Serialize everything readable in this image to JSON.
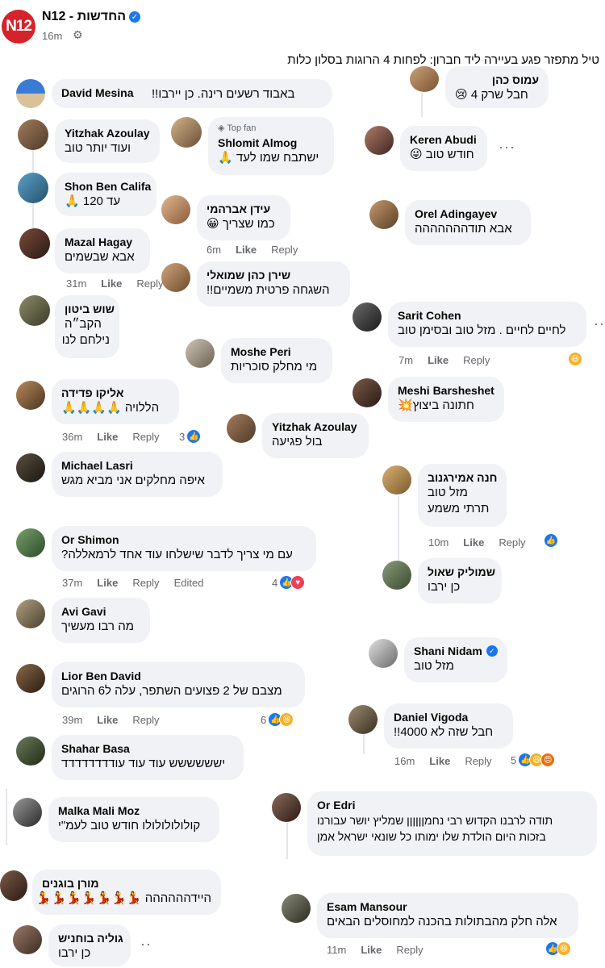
{
  "header": {
    "logo_text": "N12",
    "page_name": "N12 - החדשות",
    "post_time": "16m",
    "headline": "טיל מתפזר פגע בעיירה ליד חברון: לפחות 4 הרוגות בסלון כלות"
  },
  "colors": {
    "accent": "#1877f2",
    "bubble": "#f0f2f5",
    "brand": "#d5232c"
  },
  "actions": {
    "like": "Like",
    "reply": "Reply",
    "edited": "Edited"
  },
  "comments": [
    {
      "name": "David Mesina",
      "text": "באבוד רשעים רינה. כן יירבו!!"
    },
    {
      "name": "עמוס כהן",
      "text": "חבל שרק 4 😢"
    },
    {
      "name": "Yitzhak Azoulay",
      "text": "ועוד יותר טוב"
    },
    {
      "name": "Shlomit Almog",
      "badge": "Top fan",
      "text": "ישתבח שמו לעד 🙏"
    },
    {
      "name": "Keren Abudi",
      "text": "חודש טוב 😜"
    },
    {
      "name": "Shon Ben Califa",
      "text": "עד 120 🙏"
    },
    {
      "name": "עידן אברהמי",
      "text": "כמו שצריך 😀",
      "time": "6m"
    },
    {
      "name": "Orel Adingayev",
      "text": "אבא תודההההההה"
    },
    {
      "name": "Mazal Hagay",
      "text": "אבא שבשמים",
      "time": "31m"
    },
    {
      "name": "שירן כהן שמואלי",
      "text": "השגחה פרטית משמיים!!"
    },
    {
      "name": "שוש ביטון",
      "text": "הקב״ה",
      "text2": "נילחם לנו"
    },
    {
      "name": "Sarit Cohen",
      "text": "לחיים לחיים . מזל טוב ובסימן טוב",
      "time": "7m"
    },
    {
      "name": "Moshe Peri",
      "text": "מי מחלק סוכריות"
    },
    {
      "name": "אליקו פדידה",
      "text": "הללויה 🙏🙏🙏🙏",
      "time": "36m",
      "count": "3"
    },
    {
      "name": "Meshi Barsheshet",
      "text": "חתונה ביצוץ💥"
    },
    {
      "name": "Yitzhak Azoulay",
      "text": "בול פגיעה"
    },
    {
      "name": "Michael Lasri",
      "text": "איפה מחלקים אני מביא מגש"
    },
    {
      "name": "חנה אמירגנוב",
      "text": "מזל טוב",
      "text2": "תרתי משמע",
      "time": "10m"
    },
    {
      "name": "Or Shimon",
      "text": "עם מי צריך לדבר שישלחו עוד אחד לרמאללה?",
      "time": "37m",
      "count": "4"
    },
    {
      "name": "שמוליק שאול",
      "text": "כן ירבו"
    },
    {
      "name": "Avi Gavi",
      "text": "מה רבו מעשיך"
    },
    {
      "name": "Shani Nidam",
      "text": "מזל טוב"
    },
    {
      "name": "Lior Ben David",
      "text": "מצבם של 2 פצועים השתפר, עלה ל6 הרוגים",
      "time": "39m",
      "count": "6"
    },
    {
      "name": "Daniel Vigoda",
      "text": "חבל שזה לא 4000!!",
      "time": "16m",
      "count": "5"
    },
    {
      "name": "Shahar Basa",
      "text": "ישששששש עוד עוד עודדדדדדדד"
    },
    {
      "name": "Malka Mali Moz",
      "text": "קולולולולולו חודש טוב לעמ\"י"
    },
    {
      "name": "Or Edri",
      "text": "תודה לרבנו הקדוש רבי נחמןןןןןן שמליץ יושר עבורנו",
      "text2": "בזכות היום הולדת שלו ימותו כל שונאי ישראל אמן"
    },
    {
      "name": "מורן בוגנים",
      "text": "היידהההההה 💃💃💃💃💃💃💃"
    },
    {
      "name": "Esam Mansour",
      "text": "אלה חלק מהבתולות בהכנה למחוסלים הבאים",
      "time": "11m"
    },
    {
      "name": "גוליה בוחניש",
      "text": "כן ירבו"
    }
  ]
}
